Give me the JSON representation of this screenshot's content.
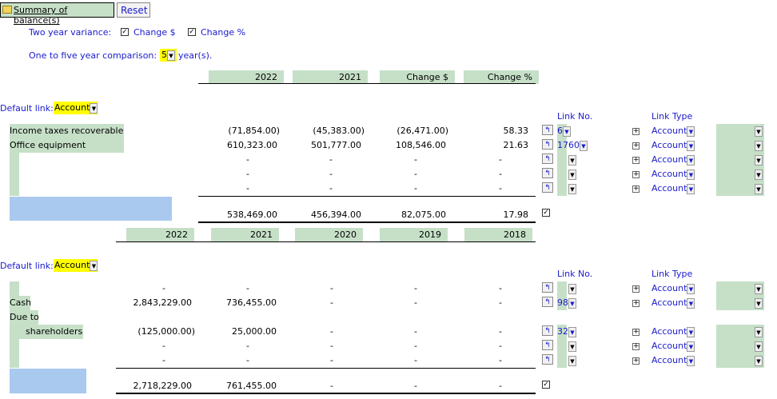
{
  "toolbar": {
    "summary_label": "Summary of balance(s)",
    "reset_label": "Reset"
  },
  "options": {
    "two_year_label": "Two year variance:",
    "change_dollar_label": "Change $",
    "change_pct_label": "Change %",
    "one_five_label": "One to five year comparison:",
    "years_value": "5",
    "years_suffix": "year(s)."
  },
  "section1": {
    "headers": [
      "2022",
      "2021",
      "Change $",
      "Change %"
    ],
    "default_link_label": "Default link:",
    "default_link_value": "Account",
    "link_no_header": "Link No.",
    "link_type_header": "Link Type",
    "rows": [
      {
        "label": "Income taxes recoverable",
        "v2022": "(71,854.00)",
        "v2021": "(45,383.00)",
        "chg": "(26,471.00)",
        "pct": "58.33",
        "link_no": "6",
        "link_type": "Account"
      },
      {
        "label": "Office equipment",
        "v2022": "610,323.00",
        "v2021": "501,777.00",
        "chg": "108,546.00",
        "pct": "21.63",
        "link_no": "1760",
        "link_type": "Account"
      },
      {
        "label": "",
        "v2022": "-",
        "v2021": "-",
        "chg": "-",
        "pct": "-",
        "link_no": "",
        "link_type": "Account"
      },
      {
        "label": "",
        "v2022": "-",
        "v2021": "-",
        "chg": "-",
        "pct": "-",
        "link_no": "",
        "link_type": "Account"
      },
      {
        "label": "",
        "v2022": "-",
        "v2021": "-",
        "chg": "-",
        "pct": "-",
        "link_no": "",
        "link_type": "Account"
      }
    ],
    "totals": {
      "v2022": "538,469.00",
      "v2021": "456,394.00",
      "chg": "82,075.00",
      "pct": "17.98"
    }
  },
  "section2": {
    "headers": [
      "2022",
      "2021",
      "2020",
      "2019",
      "2018"
    ],
    "default_link_label": "Default link:",
    "default_link_value": "Account",
    "link_no_header": "Link No.",
    "link_type_header": "Link Type",
    "rows": [
      {
        "label": "",
        "vals": [
          "-",
          "-",
          "-",
          "-",
          "-"
        ],
        "link_no": "",
        "link_type": "Account"
      },
      {
        "label": "Cash",
        "vals": [
          "2,843,229.00",
          "736,455.00",
          "-",
          "-",
          "-"
        ],
        "link_no": "98",
        "link_type": "Account"
      },
      {
        "label": "Due to",
        "label2": "shareholders",
        "vals": [
          "(125,000.00)",
          "25,000.00",
          "-",
          "-",
          "-"
        ],
        "link_no": "32",
        "link_type": "Account"
      },
      {
        "label": "",
        "vals": [
          "-",
          "-",
          "-",
          "-",
          "-"
        ],
        "link_no": "",
        "link_type": "Account"
      },
      {
        "label": "",
        "vals": [
          "-",
          "-",
          "-",
          "-",
          "-"
        ],
        "link_no": "",
        "link_type": "Account"
      }
    ],
    "totals": [
      "2,718,229.00",
      "761,455.00",
      "-",
      "-",
      "-"
    ]
  }
}
